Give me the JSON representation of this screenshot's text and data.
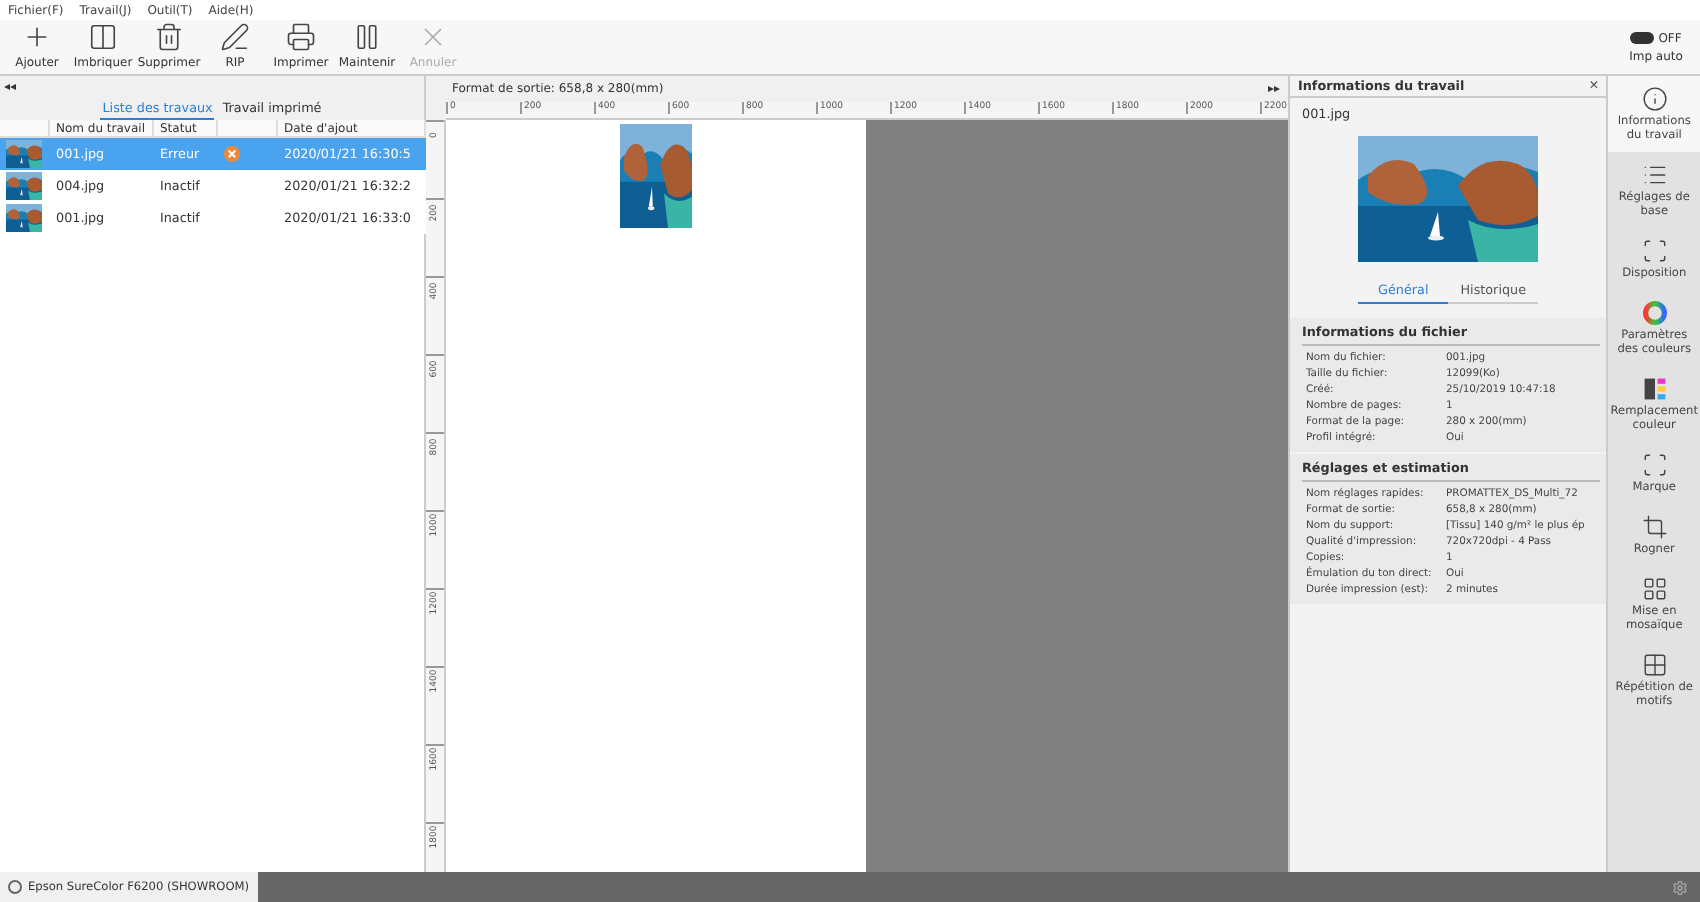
{
  "menu": [
    "Fichier(F)",
    "Travail(J)",
    "Outil(T)",
    "Aide(H)"
  ],
  "toolbar": [
    {
      "label": "Ajouter",
      "kind": "add",
      "disabled": false
    },
    {
      "label": "Imbriquer",
      "kind": "nest",
      "disabled": false
    },
    {
      "label": "Supprimer",
      "kind": "trash",
      "disabled": false
    },
    {
      "label": "RIP",
      "kind": "rip",
      "disabled": false
    },
    {
      "label": "Imprimer",
      "kind": "print",
      "disabled": false
    },
    {
      "label": "Maintenir",
      "kind": "pause",
      "disabled": false
    },
    {
      "label": "Annuler",
      "kind": "cancel",
      "disabled": true
    }
  ],
  "auto_print": {
    "state": "OFF",
    "on": false,
    "label": "Imp auto"
  },
  "left_panel": {
    "collapse": "◂◂",
    "tabs": [
      {
        "label": "Liste des travaux",
        "selected": true
      },
      {
        "label": "Travail imprimé",
        "selected": false
      }
    ],
    "columns": [
      "Nom du travail",
      "Statut",
      "Date d'ajout"
    ],
    "rows": [
      {
        "name": "001.jpg",
        "status": "Erreur",
        "error": true,
        "date": "2020/01/21 16:30:5",
        "selected": true
      },
      {
        "name": "004.jpg",
        "status": "Inactif",
        "error": false,
        "date": "2020/01/21 16:32:2",
        "selected": false
      },
      {
        "name": "001.jpg",
        "status": "Inactif",
        "error": false,
        "date": "2020/01/21 16:33:0",
        "selected": false
      }
    ]
  },
  "canvas": {
    "output_format": "Format de sortie: 658,8 x 280(mm)",
    "expand": "▸▸",
    "xticks": [
      "0",
      "200",
      "400",
      "600",
      "800",
      "1000",
      "1200",
      "1400",
      "1600",
      "1800",
      "2000",
      "2200"
    ],
    "yticks": [
      "0",
      "200",
      "400",
      "600",
      "800",
      "1000",
      "1200",
      "1400",
      "1600",
      "1800"
    ]
  },
  "info_panel": {
    "title": "Informations du travail",
    "close": "×",
    "file": "001.jpg",
    "tabs": [
      {
        "label": "Général",
        "selected": true
      },
      {
        "label": "Historique",
        "selected": false
      }
    ],
    "sections": [
      {
        "title": "Informations du fichier",
        "rows": [
          {
            "label": "Nom du fichier:",
            "value": "001.jpg"
          },
          {
            "label": "Taille du fichier:",
            "value": "12099(Ko)"
          },
          {
            "label": "Créé:",
            "value": "25/10/2019 10:47:18"
          },
          {
            "label": "Nombre de pages:",
            "value": "1"
          },
          {
            "label": "Format de la page:",
            "value": "280 x 200(mm)"
          },
          {
            "label": "Profil intégré:",
            "value": "Oui"
          }
        ]
      },
      {
        "title": "Réglages et estimation",
        "rows": [
          {
            "label": "Nom réglages rapides:",
            "value": "PROMATTEX_DS_Multi_72"
          },
          {
            "label": "Format de sortie:",
            "value": "658,8 x 280(mm)"
          },
          {
            "label": "Nom du support:",
            "value": "[Tissu] 140 g/m² le plus ép"
          },
          {
            "label": "Qualité d'impression:",
            "value": "720x720dpi - 4 Pass"
          },
          {
            "label": "Copies:",
            "value": "1"
          },
          {
            "label": "Émulation du ton direct:",
            "value": "Oui"
          },
          {
            "label": "Durée impression (est):",
            "value": "2 minutes"
          }
        ]
      }
    ]
  },
  "sidebar": [
    {
      "label": "Informations du travail",
      "kind": "info",
      "selected": true
    },
    {
      "label": "Réglages de base",
      "kind": "list",
      "selected": false
    },
    {
      "label": "Disposition",
      "kind": "layout",
      "selected": false
    },
    {
      "label": "Paramètres des couleurs",
      "kind": "color",
      "selected": false
    },
    {
      "label": "Remplacement couleur",
      "kind": "replace",
      "selected": false
    },
    {
      "label": "Marque",
      "kind": "mark",
      "selected": false
    },
    {
      "label": "Rogner",
      "kind": "crop",
      "selected": false
    },
    {
      "label": "Mise en mosaïque",
      "kind": "tile",
      "selected": false
    },
    {
      "label": "Répétition de motifs",
      "kind": "repeat",
      "selected": false
    }
  ],
  "status_bar": {
    "printer": "Epson SureColor F6200 (SHOWROOM)"
  }
}
